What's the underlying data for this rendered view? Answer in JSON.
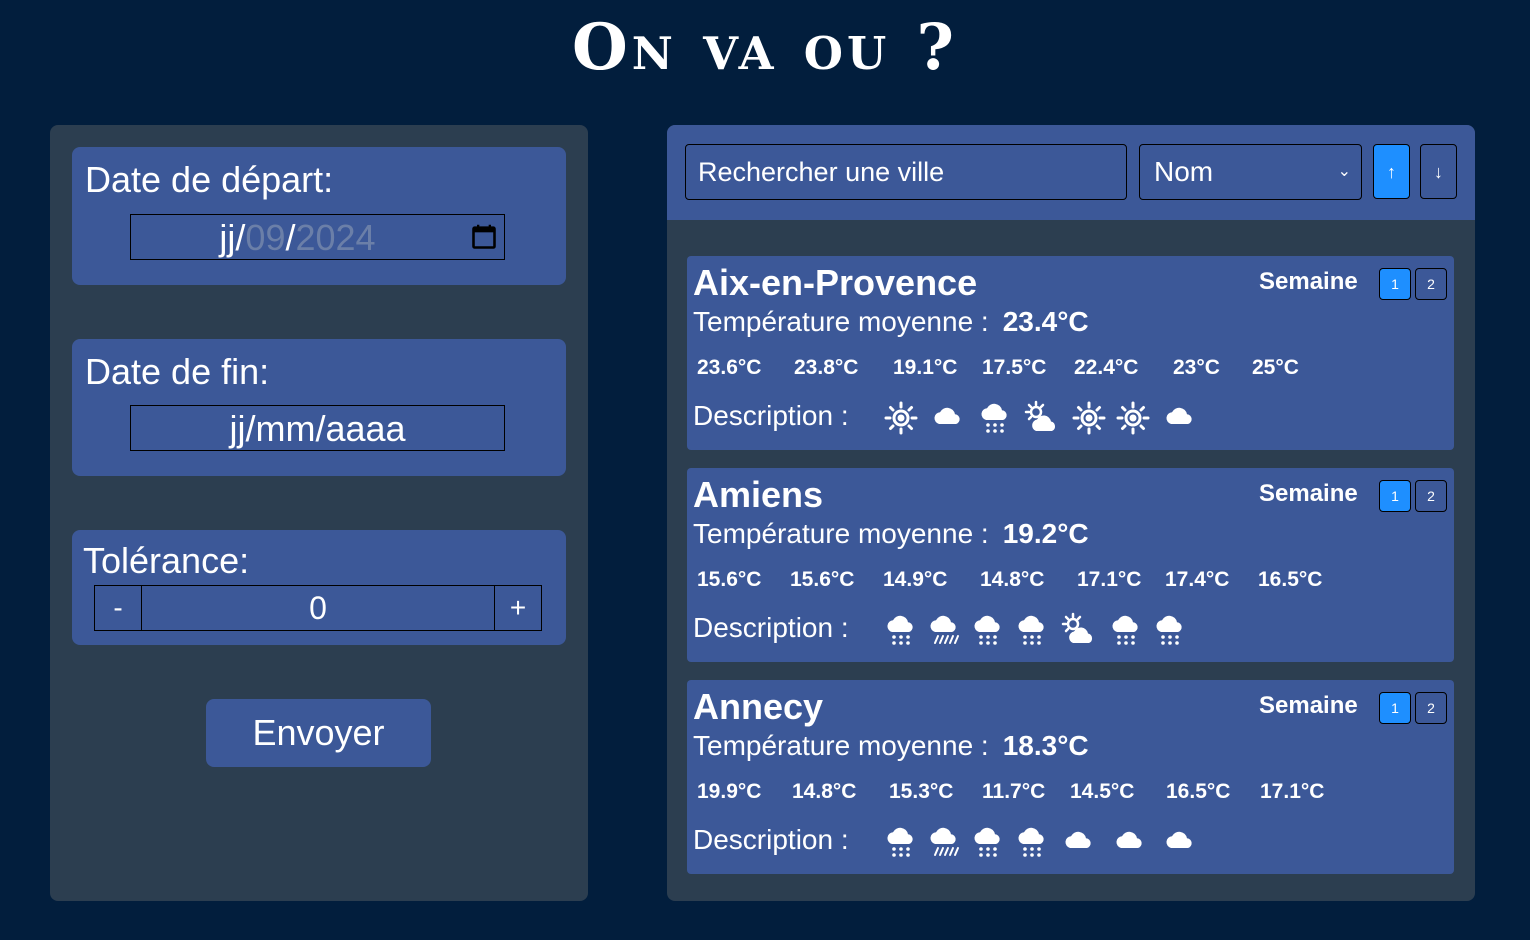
{
  "title": "On va ou ?",
  "filters": {
    "start": {
      "label": "Date de départ:",
      "day": "jj",
      "sep": "/",
      "month": "09",
      "year": "2024"
    },
    "end": {
      "label": "Date de fin:",
      "value": "jj/mm/aaaa"
    },
    "tolerance": {
      "label": "Tolérance:",
      "minus": "-",
      "value": "0",
      "plus": "+"
    },
    "submit": "Envoyer"
  },
  "toolbar": {
    "search_placeholder": "Rechercher une ville",
    "sort_value": "Nom",
    "sort_up": "↑",
    "sort_down": "↓"
  },
  "week_label": "Semaine",
  "week_buttons": [
    "1",
    "2"
  ],
  "avg_label": "Température moyenne :",
  "desc_label": "Description :",
  "cities": [
    {
      "name": "Aix-en-Provence",
      "avg": "23.4°C",
      "temps": [
        "23.6°C",
        "23.8°C",
        "19.1°C",
        "17.5°C",
        "22.4°C",
        "23°C",
        "25°C"
      ],
      "icons": [
        "sun-icon",
        "cloud-icon",
        "rain-icon",
        "sun-cloud-icon",
        "sun-icon",
        "sun-icon",
        "cloud-icon"
      ]
    },
    {
      "name": "Amiens",
      "avg": "19.2°C",
      "temps": [
        "15.6°C",
        "15.6°C",
        "14.9°C",
        "14.8°C",
        "17.1°C",
        "17.4°C",
        "16.5°C"
      ],
      "icons": [
        "rain-icon",
        "heavy-rain-icon",
        "rain-icon",
        "rain-icon",
        "sun-cloud-icon",
        "rain-icon",
        "rain-icon"
      ]
    },
    {
      "name": "Annecy",
      "avg": "18.3°C",
      "temps": [
        "19.9°C",
        "14.8°C",
        "15.3°C",
        "11.7°C",
        "14.5°C",
        "16.5°C",
        "17.1°C"
      ],
      "icons": [
        "rain-icon",
        "heavy-rain-icon",
        "rain-icon",
        "rain-icon",
        "cloud-icon",
        "cloud-icon",
        "cloud-icon"
      ]
    }
  ]
}
